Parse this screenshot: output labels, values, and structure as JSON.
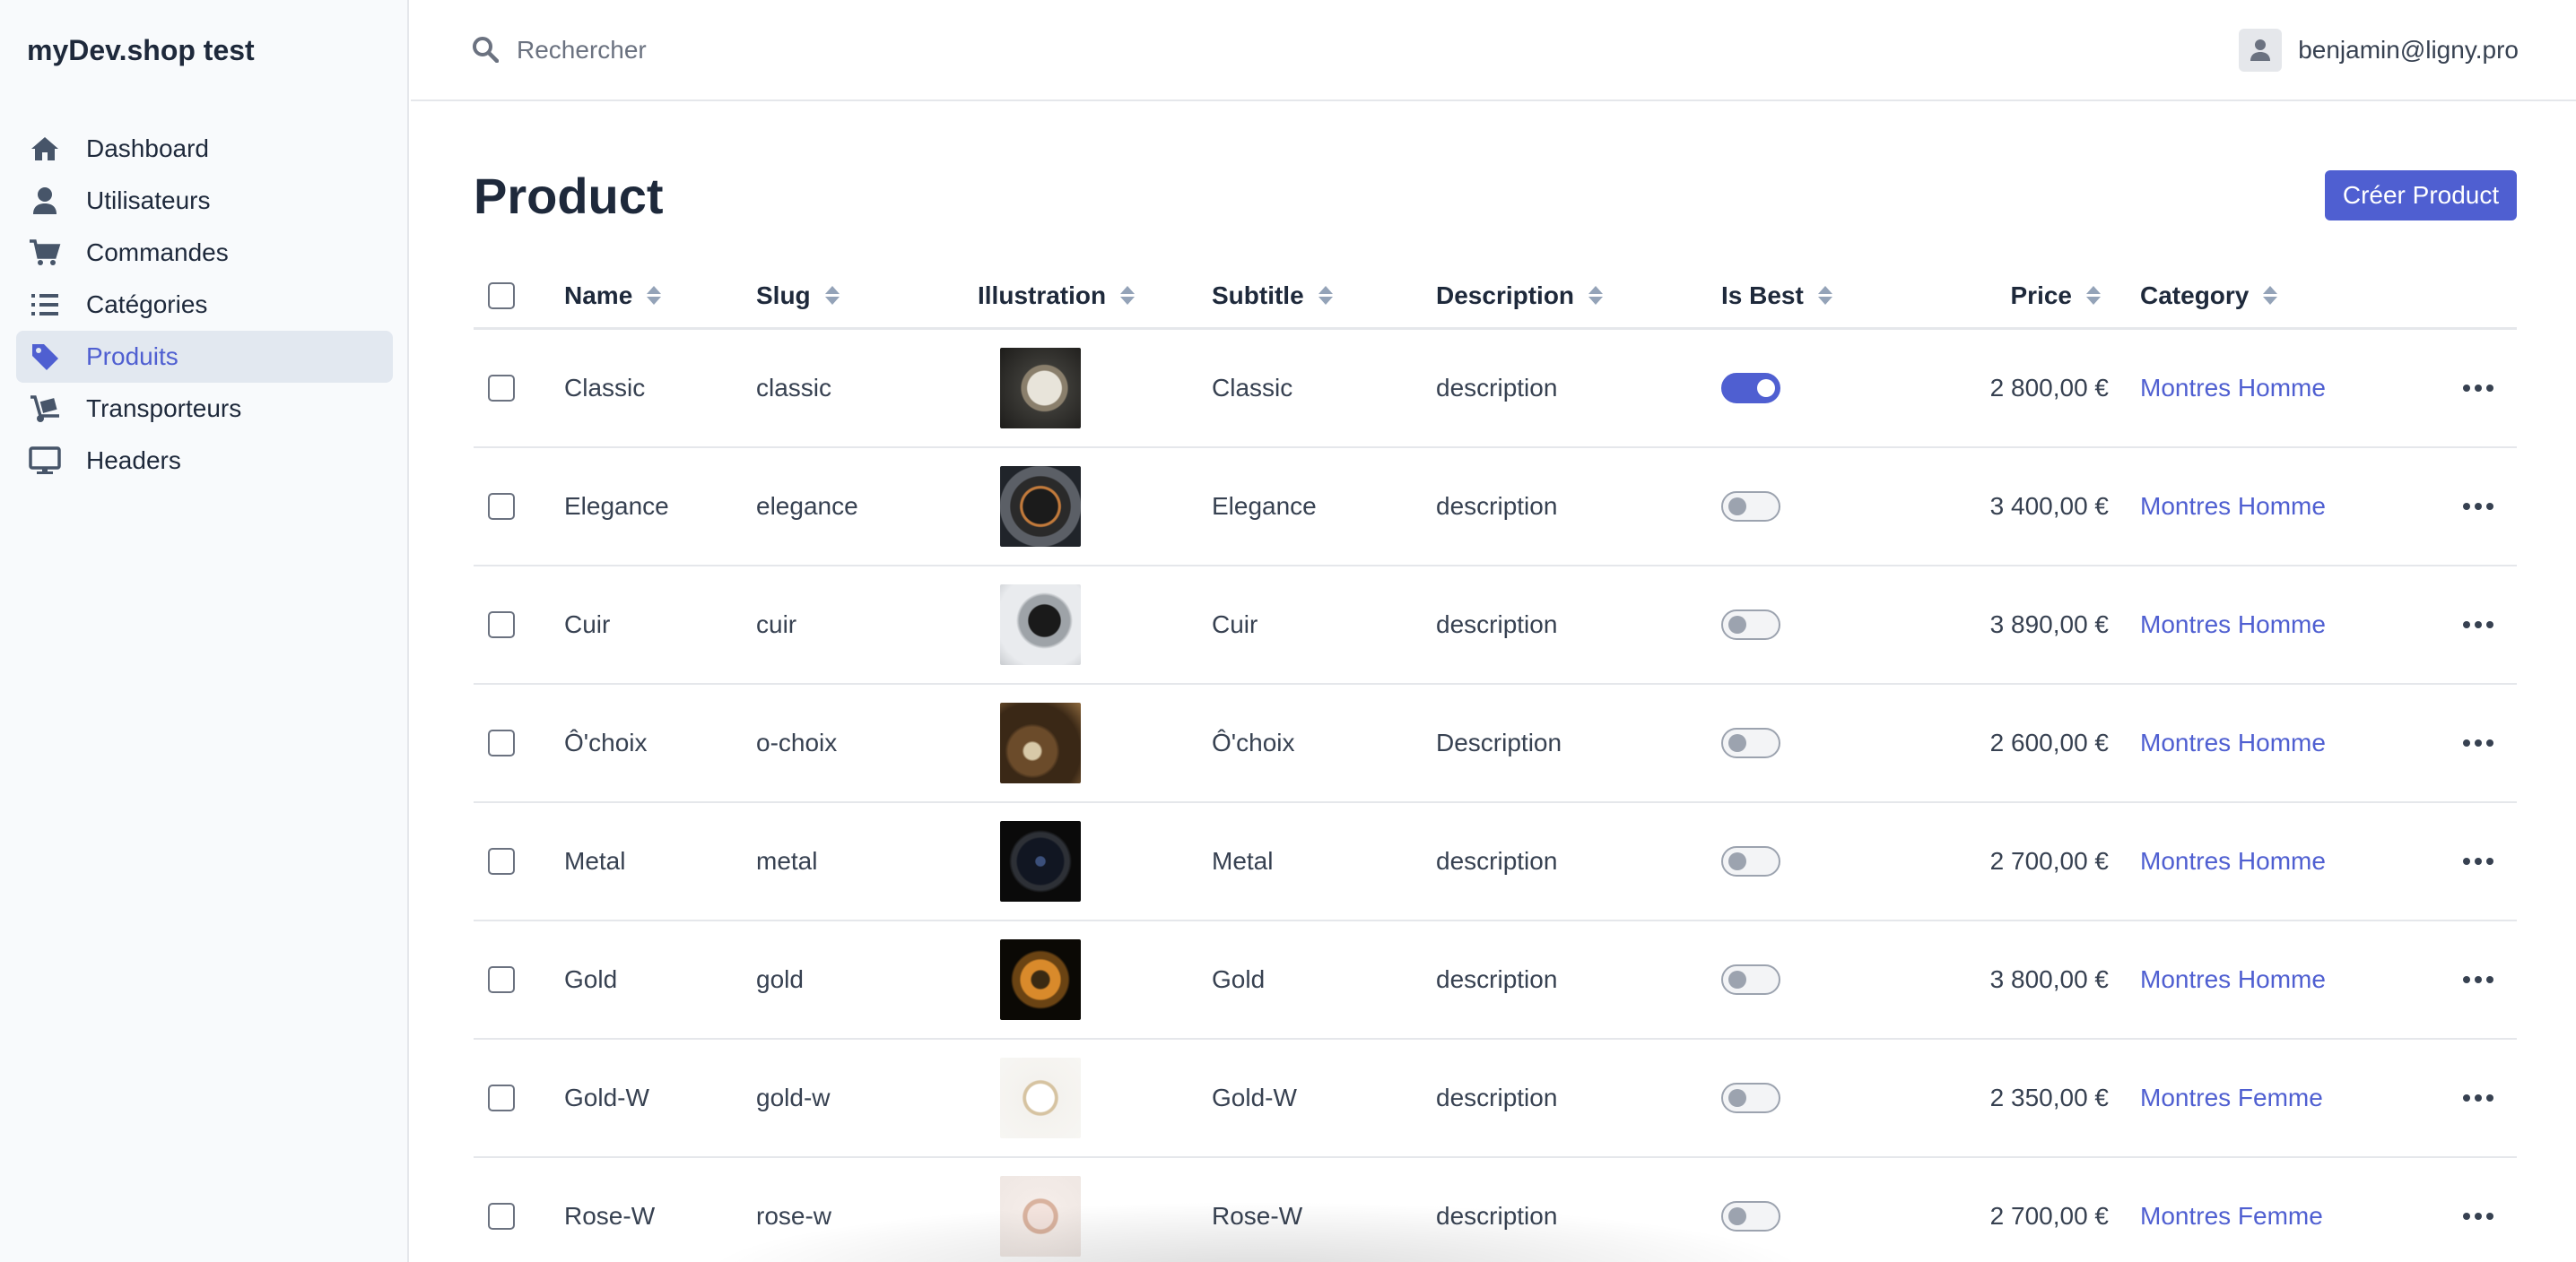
{
  "app": {
    "brand": "myDev.shop test"
  },
  "sidebar": {
    "items": [
      {
        "label": "Dashboard",
        "icon": "home-icon",
        "active": false
      },
      {
        "label": "Utilisateurs",
        "icon": "user-icon",
        "active": false
      },
      {
        "label": "Commandes",
        "icon": "cart-icon",
        "active": false
      },
      {
        "label": "Catégories",
        "icon": "list-icon",
        "active": false
      },
      {
        "label": "Produits",
        "icon": "tag-icon",
        "active": true
      },
      {
        "label": "Transporteurs",
        "icon": "dolly-icon",
        "active": false
      },
      {
        "label": "Headers",
        "icon": "monitor-icon",
        "active": false
      }
    ]
  },
  "topbar": {
    "search_placeholder": "Rechercher",
    "user_email": "benjamin@ligny.pro"
  },
  "main": {
    "title": "Product",
    "create_button": "Créer Product"
  },
  "table": {
    "columns": {
      "name": "Name",
      "slug": "Slug",
      "illustration": "Illustration",
      "subtitle": "Subtitle",
      "description": "Description",
      "is_best": "Is Best",
      "price": "Price",
      "category": "Category"
    },
    "rows": [
      {
        "name": "Classic",
        "slug": "classic",
        "subtitle": "Classic",
        "description": "description",
        "is_best": true,
        "price": "2 800,00 €",
        "category": "Montres Homme",
        "thumb": "watch-steel"
      },
      {
        "name": "Elegance",
        "slug": "elegance",
        "subtitle": "Elegance",
        "description": "description",
        "is_best": false,
        "price": "3 400,00 €",
        "category": "Montres Homme",
        "thumb": "watch-dark"
      },
      {
        "name": "Cuir",
        "slug": "cuir",
        "subtitle": "Cuir",
        "description": "description",
        "is_best": false,
        "price": "3 890,00 €",
        "category": "Montres Homme",
        "thumb": "watch-silver"
      },
      {
        "name": "Ô'choix",
        "slug": "o-choix",
        "subtitle": "Ô'choix",
        "description": "Description",
        "is_best": false,
        "price": "2 600,00 €",
        "category": "Montres Homme",
        "thumb": "watch-bronze"
      },
      {
        "name": "Metal",
        "slug": "metal",
        "subtitle": "Metal",
        "description": "description",
        "is_best": false,
        "price": "2 700,00 €",
        "category": "Montres Homme",
        "thumb": "watch-black"
      },
      {
        "name": "Gold",
        "slug": "gold",
        "subtitle": "Gold",
        "description": "description",
        "is_best": false,
        "price": "3 800,00 €",
        "category": "Montres Homme",
        "thumb": "watch-gold"
      },
      {
        "name": "Gold-W",
        "slug": "gold-w",
        "subtitle": "Gold-W",
        "description": "description",
        "is_best": false,
        "price": "2 350,00 €",
        "category": "Montres Femme",
        "thumb": "watch-white"
      },
      {
        "name": "Rose-W",
        "slug": "rose-w",
        "subtitle": "Rose-W",
        "description": "description",
        "is_best": false,
        "price": "2 700,00 €",
        "category": "Montres Femme",
        "thumb": "watch-rose"
      }
    ]
  },
  "colors": {
    "accent": "#4f5fd1",
    "sidebar_bg": "#f8fafc",
    "active_bg": "#e2e8f0"
  }
}
